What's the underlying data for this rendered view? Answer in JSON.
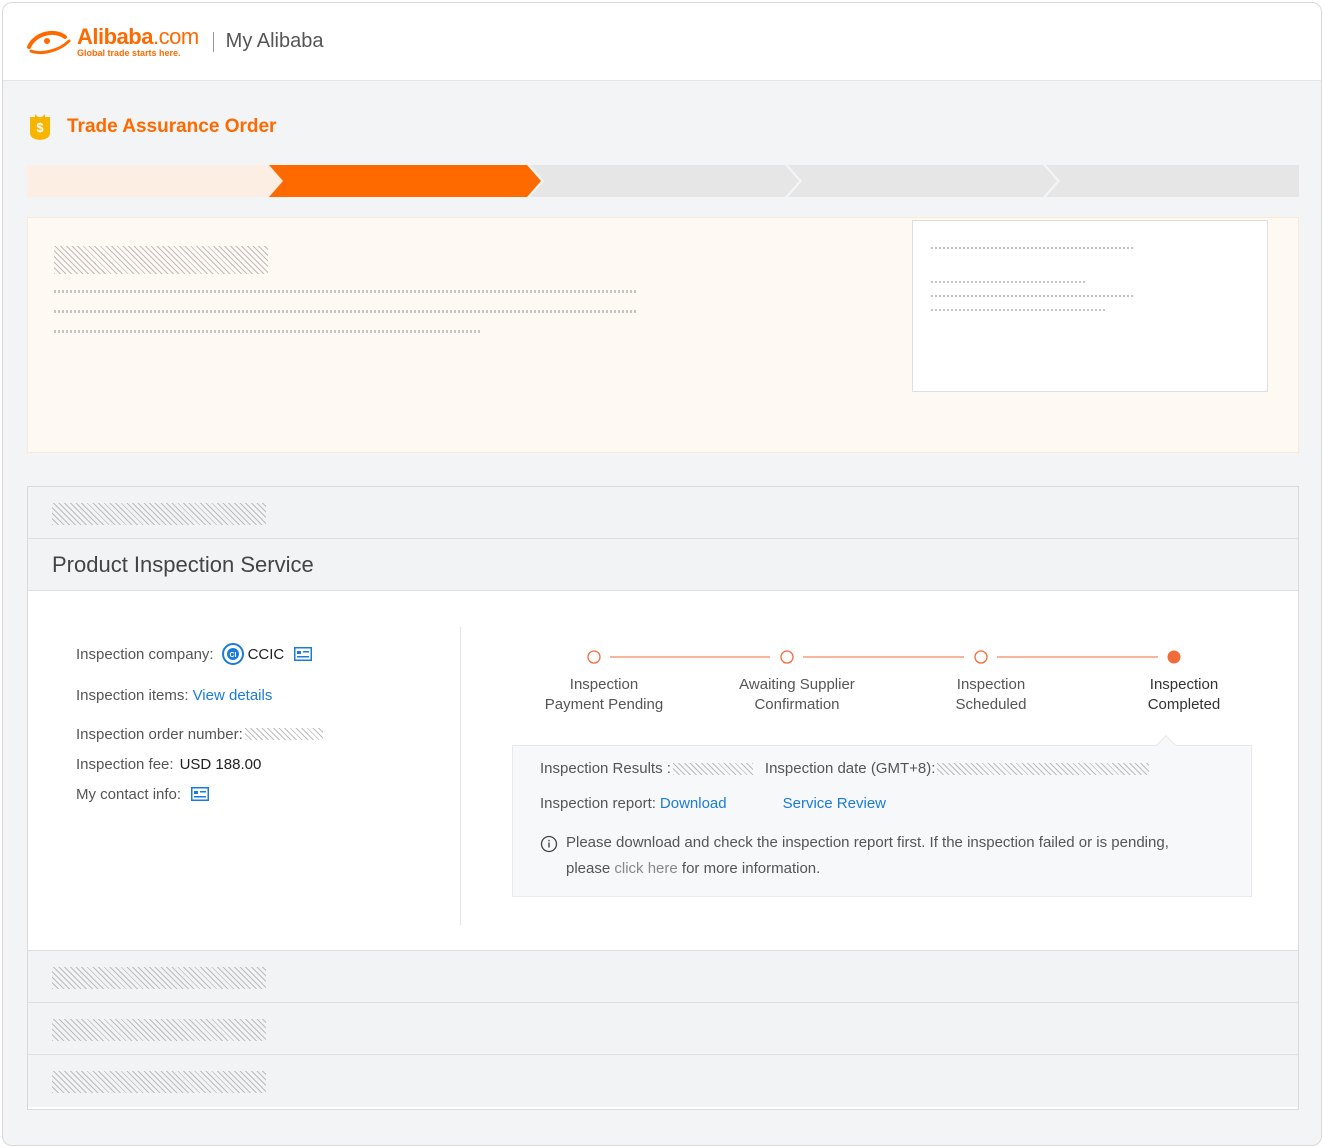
{
  "header": {
    "brand": "Alibaba",
    "brand_suffix": ".com",
    "tagline": "Global trade starts here.",
    "section": "My Alibaba"
  },
  "order": {
    "title": "Trade Assurance Order",
    "progress_active_step": 2,
    "progress_total_steps": 5
  },
  "panel": {
    "title": "Product Inspection Service"
  },
  "inspection": {
    "company_label": "Inspection company:",
    "company_name": "CCIC",
    "items_label": "Inspection items:",
    "items_link": "View details",
    "order_number_label": "Inspection order number:",
    "fee_label": "Inspection fee:",
    "fee_value": "USD 188.00",
    "contact_label": "My contact info:"
  },
  "steps": [
    {
      "line1": "Inspection",
      "line2": "Payment Pending"
    },
    {
      "line1": "Awaiting Supplier",
      "line2": "Confirmation"
    },
    {
      "line1": "Inspection",
      "line2": "Scheduled"
    },
    {
      "line1": "Inspection",
      "line2": "Completed"
    }
  ],
  "results": {
    "results_label": "Inspection Results :",
    "date_label": "Inspection date (GMT+8):",
    "report_label": "Inspection report:",
    "download_link": "Download",
    "review_link": "Service Review",
    "note_text": "Please download and check the inspection report first. If the inspection failed or is pending,",
    "note_prefix": "please",
    "note_link": "click here",
    "note_suffix": "for more information."
  },
  "colors": {
    "accent": "#ff6a00",
    "link": "#1a7bd8",
    "step_dot": "#f26b3a"
  }
}
